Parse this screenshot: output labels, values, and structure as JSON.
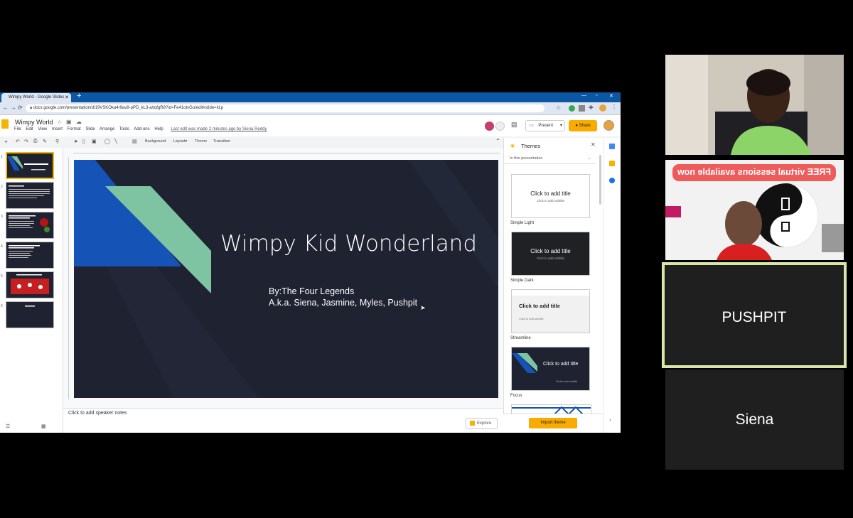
{
  "browser": {
    "tab_title": "Wimpy World - Google Slides",
    "new_tab": "+",
    "url": "docs.google.com/presentation/d/19VSKOka4r9av8-pPD_kL3-a/tqfgR8?id=Fe41otvGu/edit#slide=id.p"
  },
  "doc": {
    "title": "Wimpy World",
    "menus": [
      "File",
      "Edit",
      "View",
      "Insert",
      "Format",
      "Slide",
      "Arrange",
      "Tools",
      "Add-ons",
      "Help"
    ],
    "last_edit": "Last edit was made 2 minutes ago by Siena Reddy",
    "present_label": "Present",
    "share_label": "Share"
  },
  "toolbar": {
    "background": "Background",
    "layout": "Layout▾",
    "theme": "Theme",
    "transition": "Transition"
  },
  "slide": {
    "title": "Wimpy Kid Wonderland",
    "subtitle_line1": "By:The Four Legends",
    "subtitle_line2": "A.k.a. Siena, Jasmine, Myles, Pushpit"
  },
  "notes": {
    "placeholder": "Click to add speaker notes"
  },
  "themes_panel": {
    "title": "Themes",
    "section": "In this presentation",
    "cards": [
      {
        "name": "Simple Light",
        "title": "Click to add title",
        "subtitle": "Click to add subtitle"
      },
      {
        "name": "Simple Dark",
        "title": "Click to add title",
        "subtitle": "Click to add subtitle"
      },
      {
        "name": "Streamline",
        "title": "Click to add title",
        "subtitle": "Click to add subtitle"
      },
      {
        "name": "Focus",
        "title": "Click to add title",
        "subtitle": "Click to add subtitle"
      }
    ],
    "import_label": "Import theme"
  },
  "explore": {
    "label": "Explore"
  },
  "participants": {
    "banner": "FREE virtual sessions available now",
    "pushpit": "PUSHPIT",
    "siena": "Siena"
  },
  "colors": {
    "share_yellow": "#f9ab00",
    "slide_bg": "#1e2231",
    "accent_blue": "#1553b6",
    "accent_green": "#7ec4a2",
    "active_speaker": "#d8e7a8"
  }
}
